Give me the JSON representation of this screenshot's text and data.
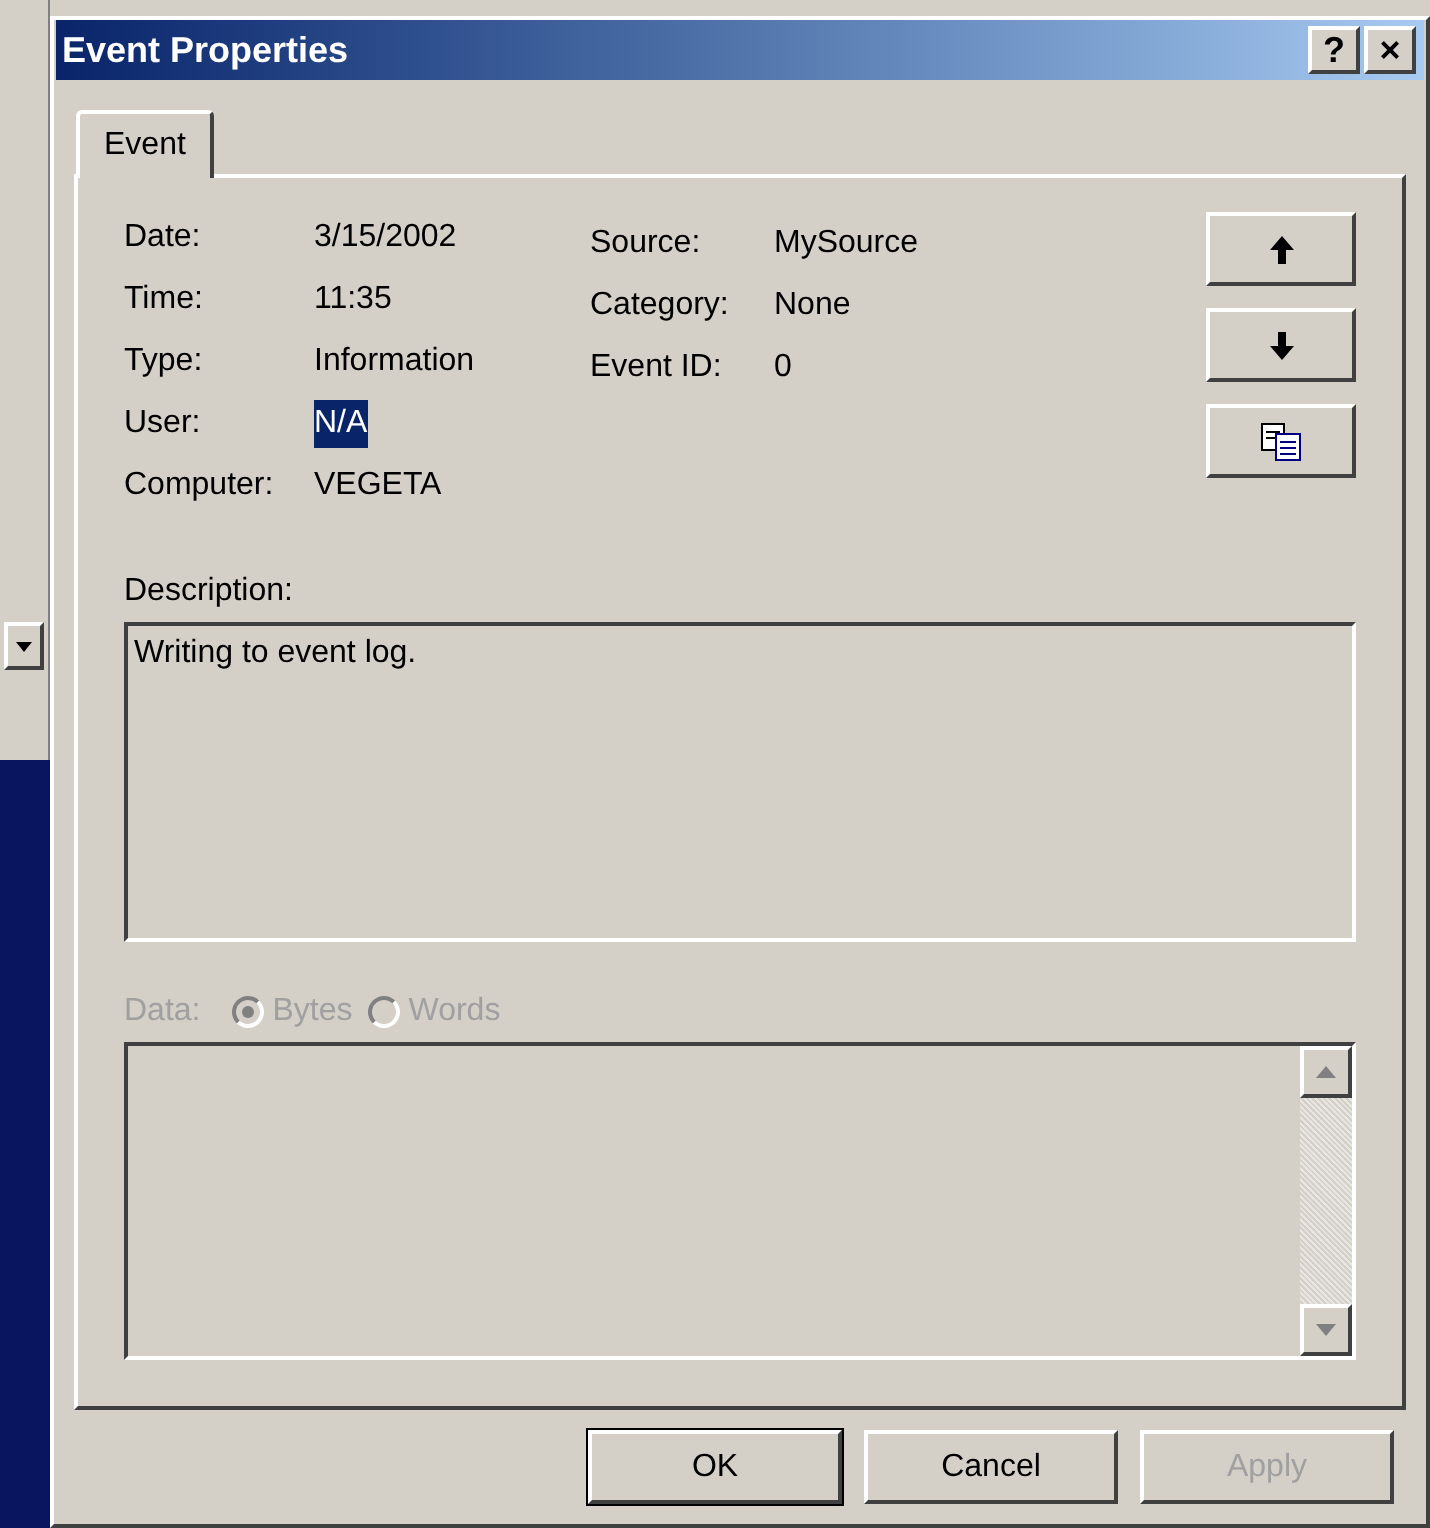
{
  "window": {
    "title": "Event Properties",
    "title_buttons": [
      "?",
      "×"
    ]
  },
  "tabs": [
    {
      "label": "Event",
      "selected": true
    }
  ],
  "fields": [
    {
      "label": "Date:",
      "value": "3/15/2002",
      "selected": false
    },
    {
      "label": "Time:",
      "value": "11:35",
      "selected": false
    },
    {
      "label": "Type:",
      "value": "Information",
      "selected": false
    },
    {
      "label": "User:",
      "value": "N/A",
      "selected": true
    },
    {
      "label": "Computer:",
      "value": "VEGETA",
      "selected": false
    }
  ],
  "fields_right": [
    {
      "label": "Source:",
      "value": "MySource"
    },
    {
      "label": "Category:",
      "value": "None"
    },
    {
      "label": "Event ID:",
      "value": "0"
    }
  ],
  "nav_buttons": [
    {
      "kind": "up"
    },
    {
      "kind": "down"
    },
    {
      "kind": "copy"
    }
  ],
  "description": {
    "label": "Description:",
    "text": "Writing to event log."
  },
  "data": {
    "label": "Data:",
    "disabled": true,
    "options": [
      {
        "label": "Bytes",
        "selected": true
      },
      {
        "label": "Words",
        "selected": false
      }
    ]
  },
  "buttons": [
    {
      "label": "OK",
      "default": true,
      "disabled": false
    },
    {
      "label": "Cancel",
      "default": false,
      "disabled": false
    },
    {
      "label": "Apply",
      "default": false,
      "disabled": true
    }
  ]
}
